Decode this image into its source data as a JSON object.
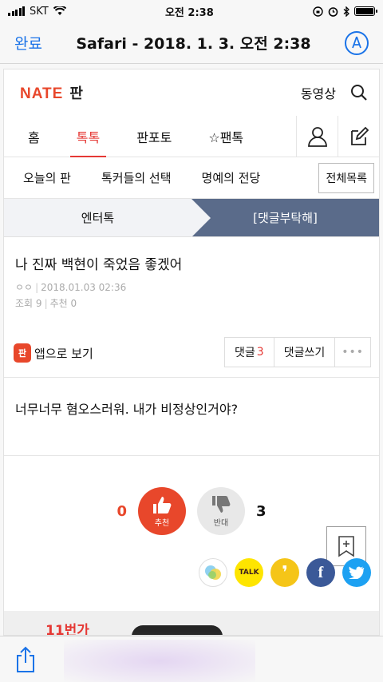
{
  "status": {
    "carrier": "SKT",
    "time": "오전 2:38"
  },
  "nav": {
    "done": "완료",
    "title": "Safari - 2018. 1. 3. 오전 2:38"
  },
  "header": {
    "logo": "NATE",
    "logo_sub": "판",
    "video": "동영상"
  },
  "main_tabs": [
    "홈",
    "톡톡",
    "판포토",
    "☆팬톡"
  ],
  "sub_tabs": [
    "오늘의 판",
    "톡커들의 선택",
    "명예의 전당"
  ],
  "sub_all": "전체목록",
  "categories": {
    "left": "엔터톡",
    "right": "[댓글부탁해]"
  },
  "post": {
    "title": "나 진짜 백현이 죽었음 좋겠어",
    "author": "ㅇㅇ",
    "date": "2018.01.03 02:36",
    "views_label": "조회",
    "views": "9",
    "recs_label": "추천",
    "recs": "0",
    "app_view": "앱으로 보기",
    "app_icon_text": "판",
    "comment_label": "댓글",
    "comment_count": "3",
    "write_comment": "댓글쓰기",
    "more": "•••",
    "body": "너무너무 혐오스러워. 내가 비정상인거야?"
  },
  "votes": {
    "up_count": "0",
    "up_label": "추천",
    "down_label": "반대",
    "down_count": "3"
  },
  "share": {
    "kakaotalk": "TALK"
  },
  "ad": {
    "brand": "11번가"
  }
}
